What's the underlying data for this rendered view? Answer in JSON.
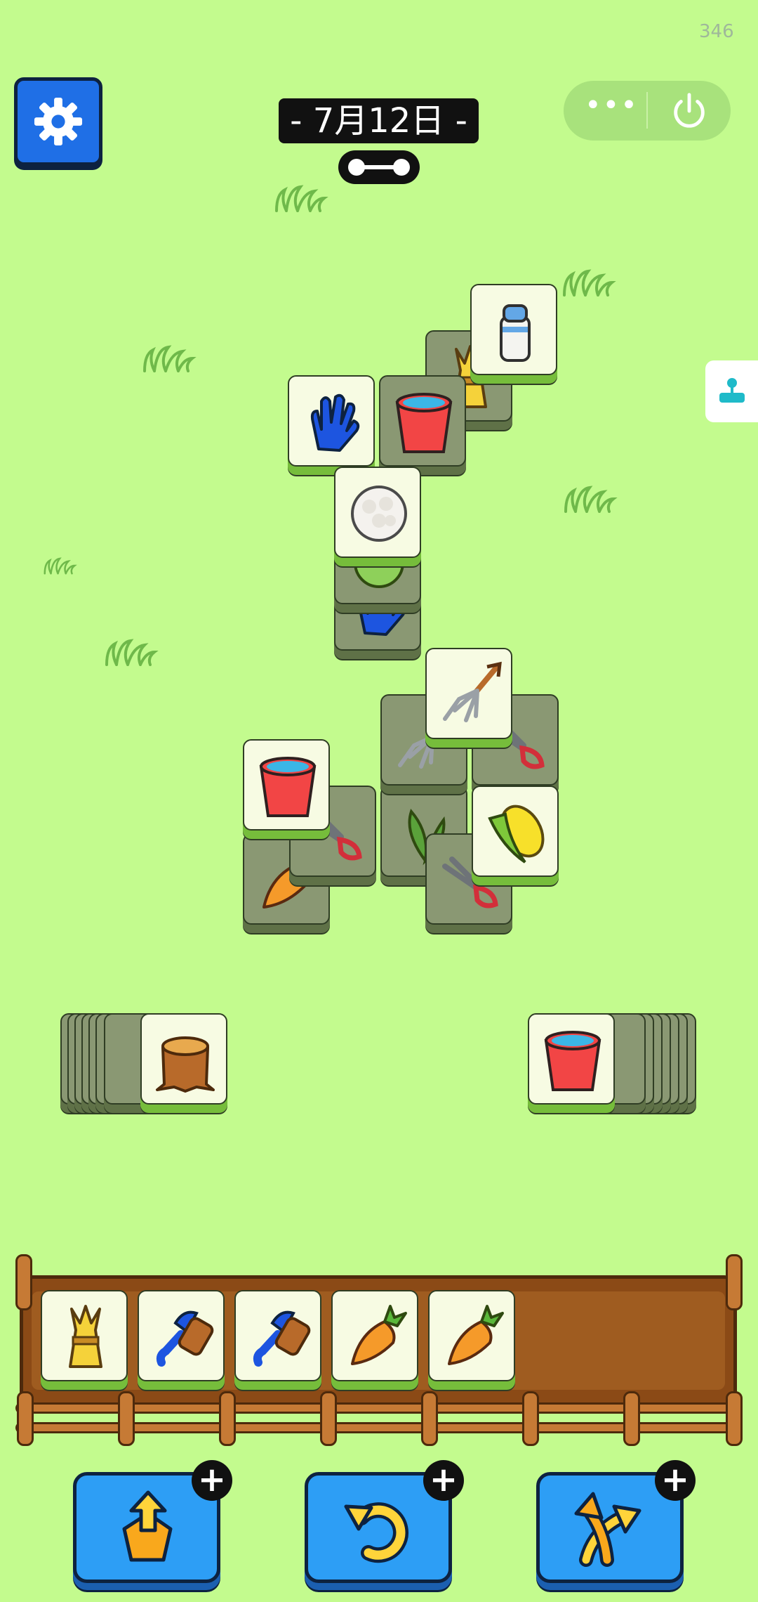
{
  "status": {
    "counter": "346"
  },
  "header": {
    "date_label": "- 7月12日 -",
    "settings_icon": "gear-icon",
    "more_icon": "more-dots-icon",
    "power_icon": "power-icon",
    "side_icon": "game-controller-icon"
  },
  "board": {
    "top_tiles": [
      "milk-bottle",
      "glove",
      "cauliflower",
      "pitchfork",
      "water-bucket",
      "corn"
    ],
    "under_tiles": [
      "wheat",
      "water-bucket",
      "cabbage",
      "glove",
      "pitchfork",
      "shears",
      "carrot",
      "shears",
      "leaves",
      "shears"
    ]
  },
  "stacks": {
    "left": {
      "top_item": "tree-stump",
      "hidden_count": 7
    },
    "right": {
      "top_item": "water-bucket",
      "hidden_count": 7
    }
  },
  "tray": {
    "slots": [
      "wheat",
      "brush",
      "brush",
      "carrot",
      "carrot"
    ],
    "capacity": 7
  },
  "tools": [
    {
      "name": "move-out",
      "icon": "pop-up-icon",
      "plus": "+"
    },
    {
      "name": "undo",
      "icon": "undo-icon",
      "plus": "+"
    },
    {
      "name": "shuffle",
      "icon": "shuffle-icon",
      "plus": "+"
    }
  ],
  "colors": {
    "background": "#c3fb8e",
    "tile_face": "#f7fbe3",
    "tile_rim": "#76bd3b",
    "button": "#2d9ef5",
    "tray": "#8b4a16"
  }
}
